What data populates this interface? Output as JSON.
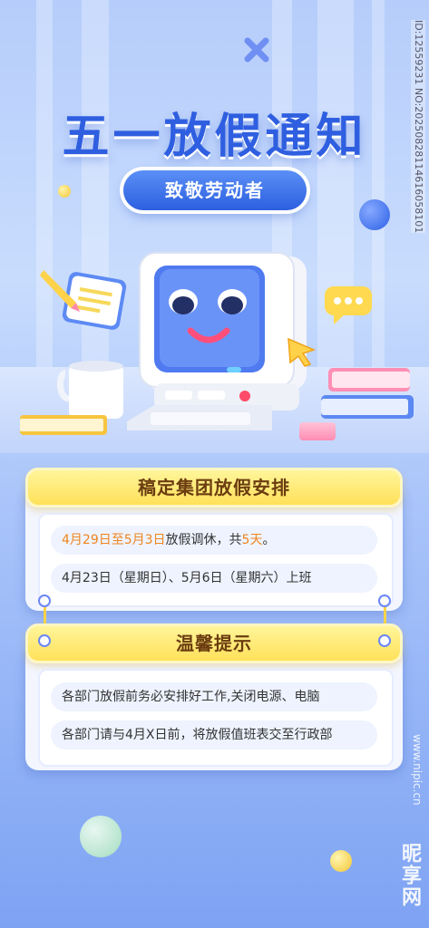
{
  "poster": {
    "title": "五一放假通知",
    "subtitle": "致敬劳动者",
    "watermark": "ID:12559231 NO:20250828114616058101",
    "site_mark": "www.nipic.cn",
    "brand_logo": "昵享网"
  },
  "section1": {
    "heading": "稿定集团放假安排",
    "line1": {
      "prefix": "4月29日至5月3日",
      "middle": "放假调休，共",
      "days": "5天",
      "suffix": "。"
    },
    "line2": "4月23日（星期日）、5月6日（星期六）上班"
  },
  "section2": {
    "heading": "温馨提示",
    "line1": "各部门放假前务必安排好工作,关闭电源、电脑",
    "line2": "各部门请与4月X日前，将放假值班表交至行政部"
  },
  "colors": {
    "title_blue": "#2f5fe0",
    "highlight_orange": "#f0851f",
    "header_yellow": "#ffe15a",
    "heading_brown": "#6b3d10"
  }
}
